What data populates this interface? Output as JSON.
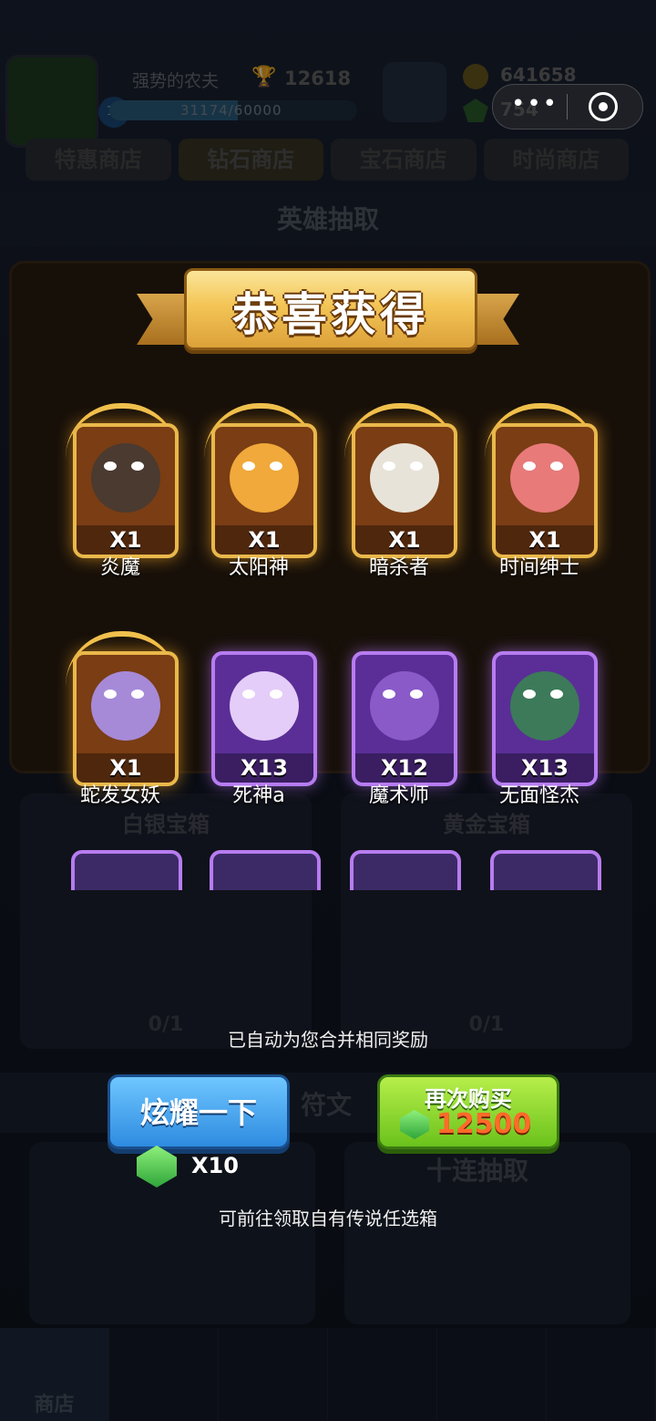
{
  "background": {
    "player": {
      "name": "强势的农夫",
      "trophies": "12618",
      "level": "15",
      "xp_text": "31174/60000",
      "xp_progress": 0.52
    },
    "currency": {
      "coins": "641658",
      "gems": "754"
    },
    "shop_tabs": [
      "特惠商店",
      "钻石商店",
      "宝石商店",
      "时尚商店"
    ],
    "section_title": "英雄抽取",
    "chests": [
      {
        "title": "白银宝箱",
        "count": "0/1"
      },
      {
        "title": "黄金宝箱",
        "count": "0/1"
      }
    ],
    "rune_title": "符文",
    "ten_draw_title": "十连抽取",
    "nav_active_label": "商店"
  },
  "capsule": {
    "dots": "•••"
  },
  "popup": {
    "title": "恭喜获得",
    "heroes": [
      {
        "name": "炎魔",
        "qty": "X1",
        "rarity": "gold",
        "color": "#4a3a30"
      },
      {
        "name": "太阳神",
        "qty": "X1",
        "rarity": "gold",
        "color": "#f0a93a"
      },
      {
        "name": "暗杀者",
        "qty": "X1",
        "rarity": "gold",
        "color": "#e8e3d8"
      },
      {
        "name": "时间绅士",
        "qty": "X1",
        "rarity": "gold",
        "color": "#e87a7a"
      },
      {
        "name": "蛇发女妖",
        "qty": "X1",
        "rarity": "gold",
        "color": "#a68ad8"
      },
      {
        "name": "死神a",
        "qty": "X13",
        "rarity": "purple",
        "color": "#e4cdf8"
      },
      {
        "name": "魔术师",
        "qty": "X12",
        "rarity": "purple",
        "color": "#8a5ac8"
      },
      {
        "name": "无面怪杰",
        "qty": "X13",
        "rarity": "purple",
        "color": "#3c7a5a"
      }
    ],
    "merge_hint": "已自动为您合并相同奖励",
    "show_button": "炫耀一下",
    "show_reward_qty": "X10",
    "buy_again_label": "再次购买",
    "buy_again_price": "12500",
    "legend_hint": "可前往领取自有传说任选箱"
  }
}
